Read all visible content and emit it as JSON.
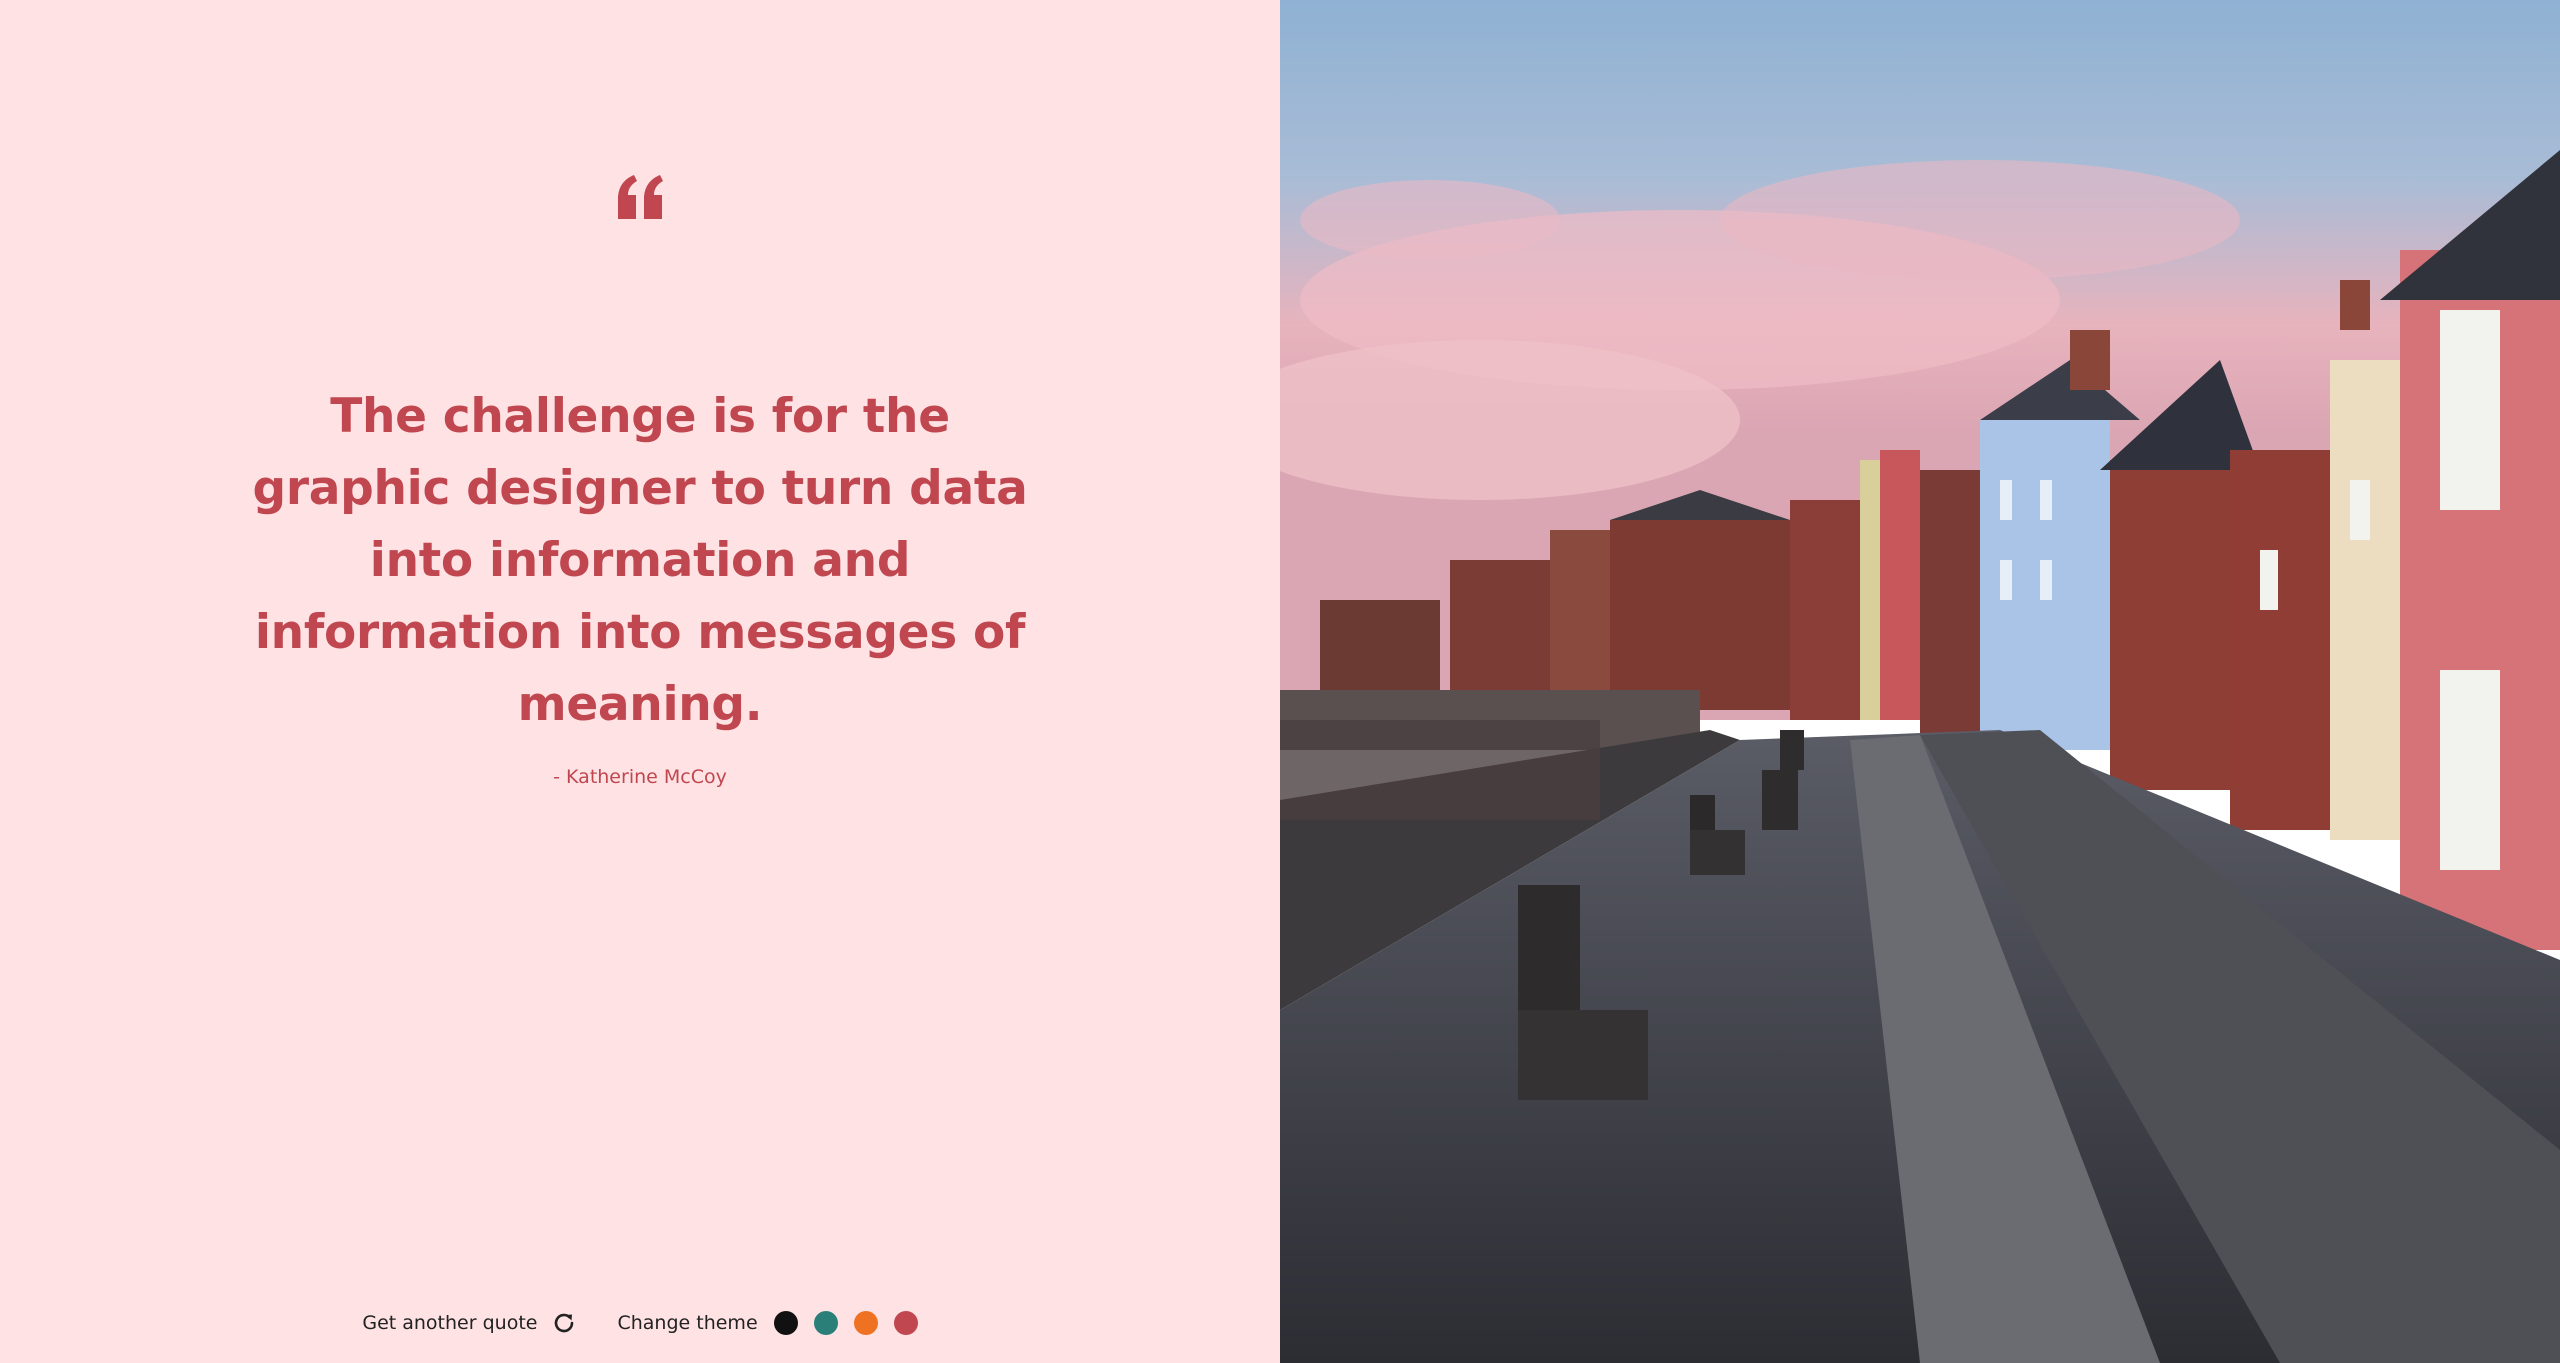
{
  "quote": {
    "mark_icon": "quote-open-icon",
    "text": "The challenge is for the graphic designer to turn data into information and information into messages of meaning.",
    "author": "- Katherine McCoy",
    "accent_color": "#c0474f",
    "background_color": "#ffe3e4"
  },
  "controls": {
    "new_quote_label": "Get another quote",
    "new_quote_icon": "refresh-icon",
    "theme_label": "Change theme",
    "themes": [
      {
        "name": "black",
        "color": "#111111"
      },
      {
        "name": "teal",
        "color": "#2a7f79"
      },
      {
        "name": "orange",
        "color": "#ef7223"
      },
      {
        "name": "rose",
        "color": "#c0474f"
      }
    ]
  },
  "image": {
    "description_icon": "street-photo-image"
  }
}
